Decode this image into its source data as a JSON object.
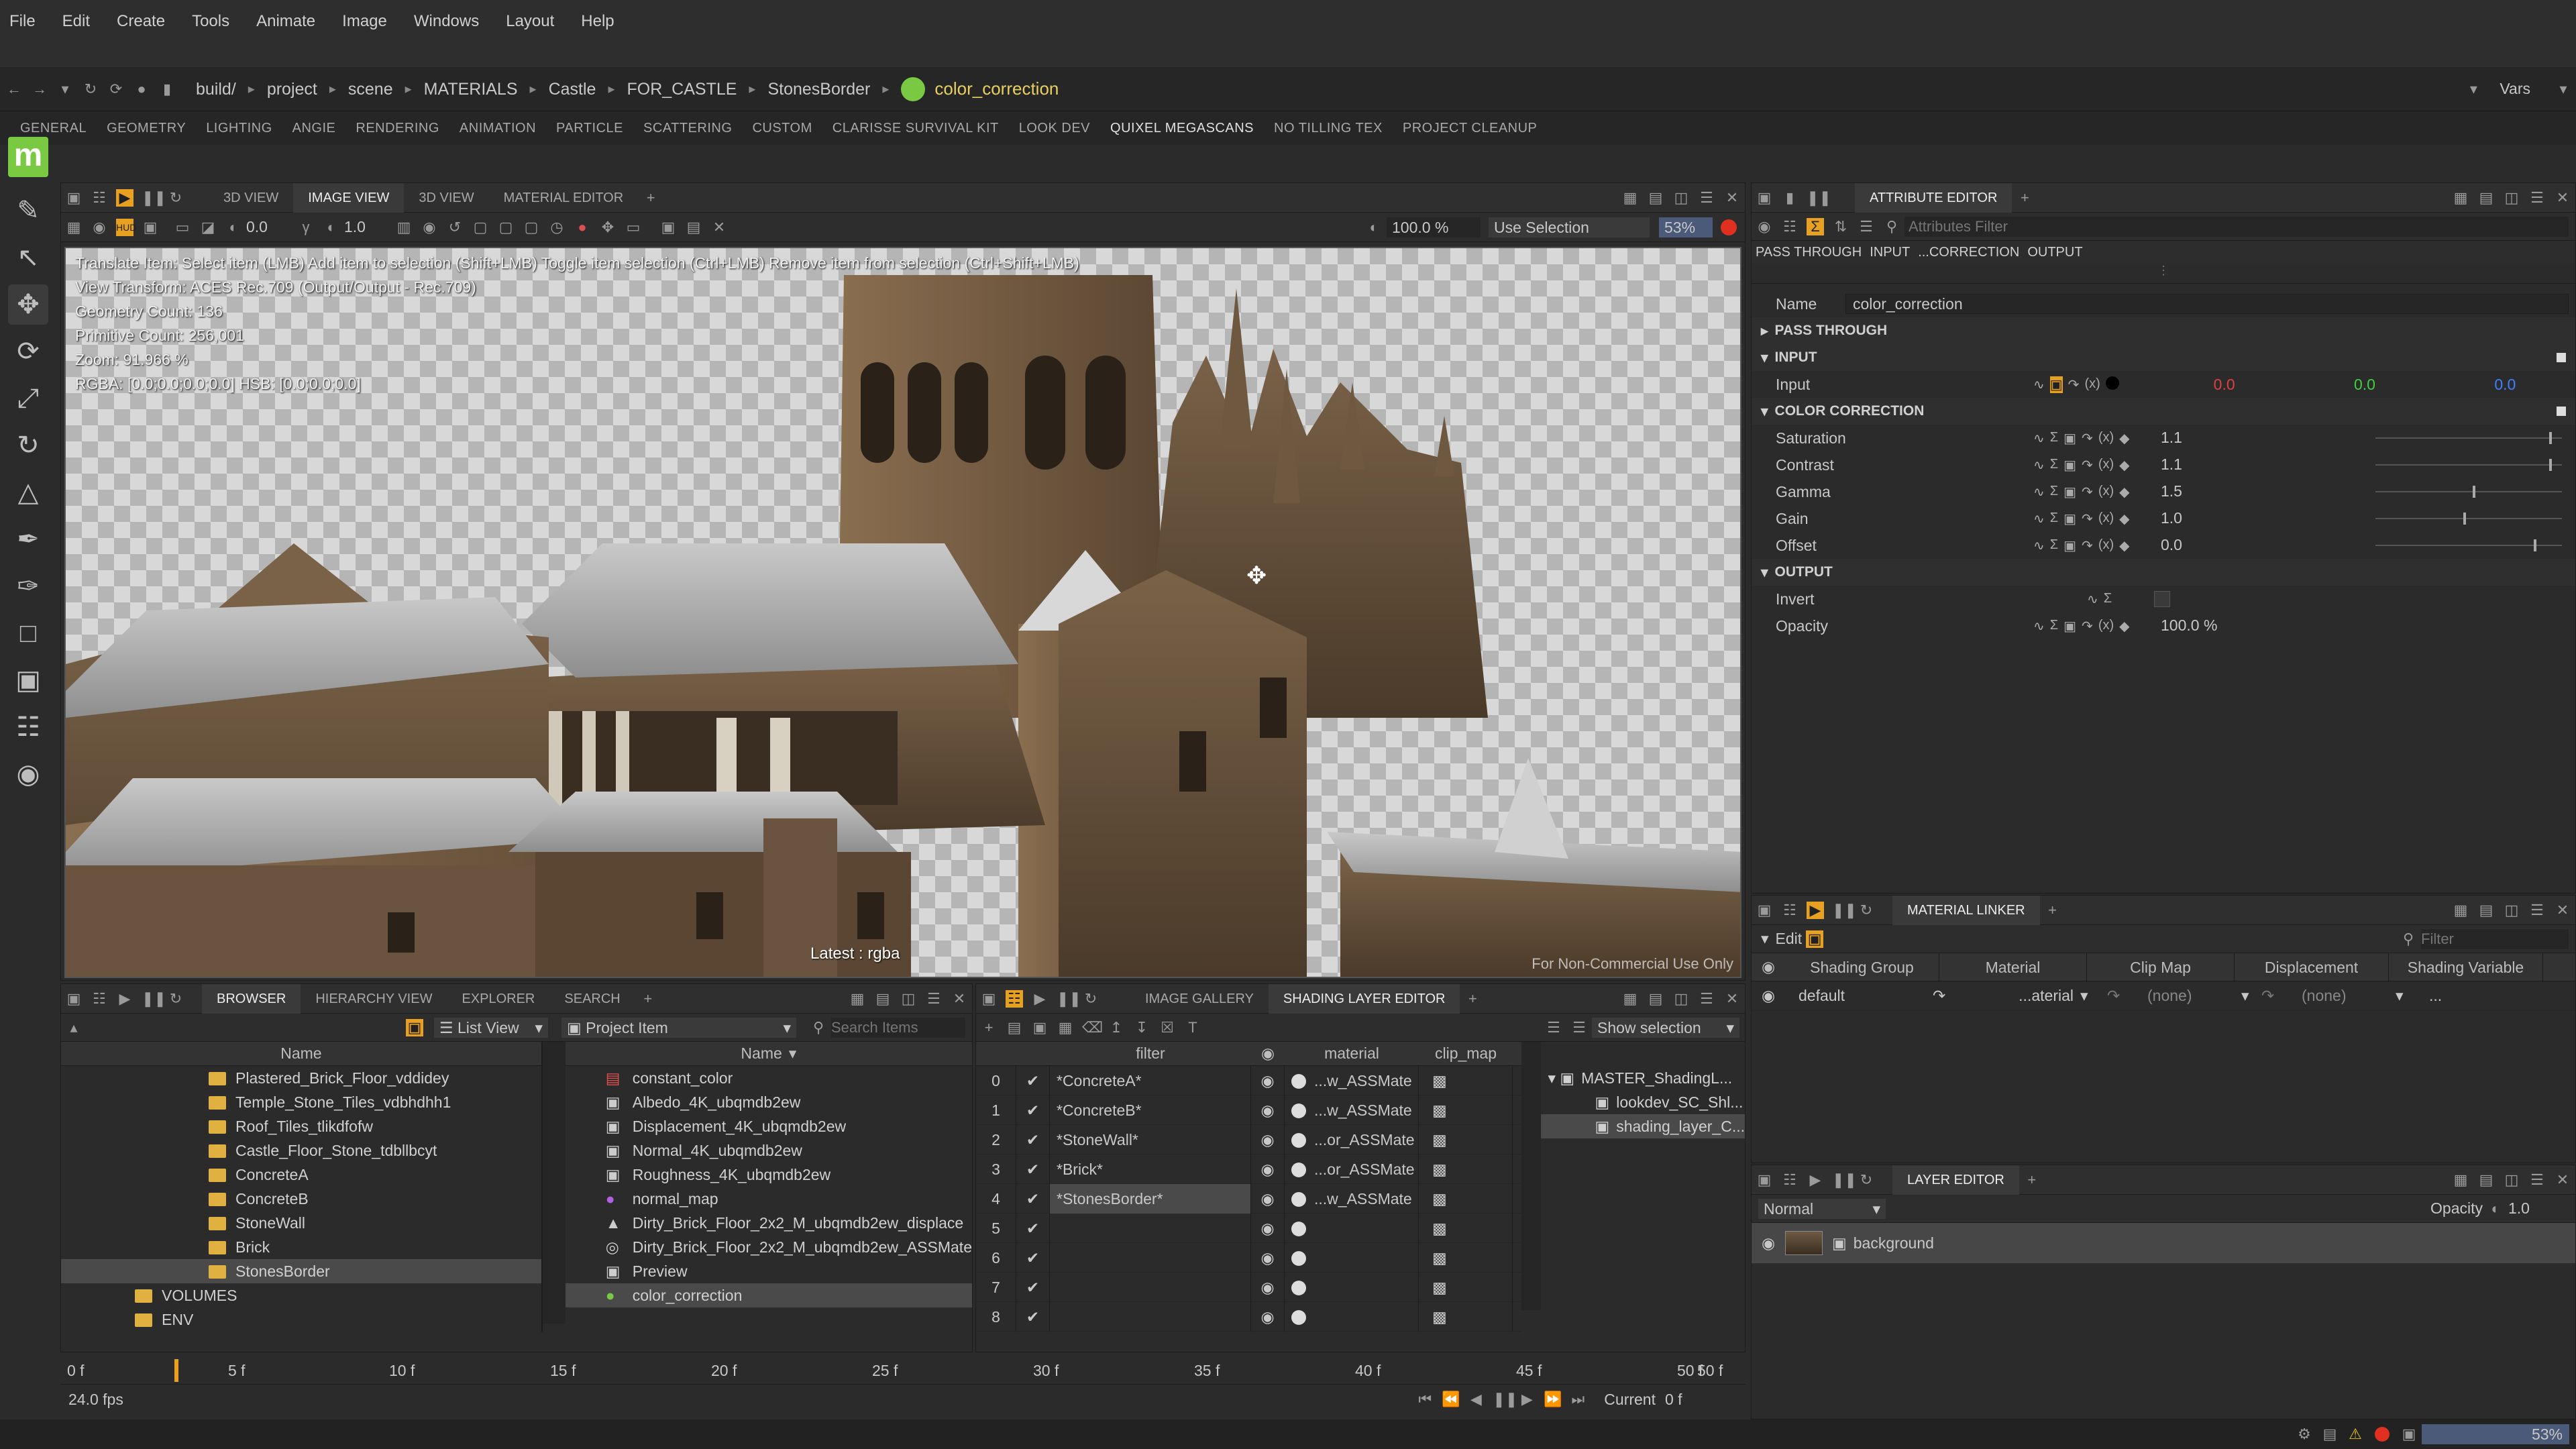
{
  "menubar": {
    "items": [
      "File",
      "Edit",
      "Create",
      "Tools",
      "Animate",
      "Image",
      "Windows",
      "Layout",
      "Help"
    ]
  },
  "path": {
    "crumbs": [
      "build/",
      "project",
      "scene",
      "MATERIALS",
      "Castle",
      "FOR_CASTLE",
      "StonesBorder"
    ],
    "current": "color_correction",
    "current_color": "#7ac943",
    "vars_label": "Vars"
  },
  "shelf_tabs": [
    "GENERAL",
    "GEOMETRY",
    "LIGHTING",
    "ANGIE",
    "RENDERING",
    "ANIMATION",
    "PARTICLE",
    "SCATTERING",
    "CUSTOM",
    "CLARISSE SURVIVAL KIT",
    "LOOK DEV",
    "QUIXEL MEGASCANS",
    "NO TILLING TEX",
    "PROJECT CLEANUP"
  ],
  "logo": {
    "letter": "m",
    "color": "#7ac943"
  },
  "viewer": {
    "tabs": [
      "3D VIEW",
      "IMAGE VIEW",
      "3D VIEW",
      "MATERIAL EDITOR"
    ],
    "active_tab": 1,
    "exposure": "0.0",
    "gamma": "1.0",
    "zoom_field": "100.0 %",
    "selection_mode": "Use Selection",
    "percent": "53",
    "percent_unit": "%",
    "info_lines": [
      "Translate Item: Select item (LMB) Add item to selection (Shift+LMB) Toggle item selection (Ctrl+LMB) Remove item from selection (Ctrl+Shift+LMB)",
      "View Transform: ACES Rec.709 (Output/Output - Rec.709)",
      "Geometry Count: 136",
      "Primitive Count: 256,001",
      "Zoom: 91.966 %",
      "RGBA: [0.0;0.0;0.0;0.0] HSB: [0.0;0.0;0.0]"
    ],
    "latest_label": "Latest : rgba",
    "watermark": "For Non-Commercial Use Only"
  },
  "attribute_editor": {
    "title": "ATTRIBUTE EDITOR",
    "filter_placeholder": "Attributes Filter",
    "subtabs": [
      "PASS THROUGH",
      "INPUT",
      "...CORRECTION",
      "OUTPUT"
    ],
    "name_label": "Name",
    "name_value": "color_correction",
    "sections": {
      "pass_through": "PASS THROUGH",
      "input": "INPUT",
      "color_correction": "COLOR CORRECTION",
      "output": "OUTPUT"
    },
    "input": {
      "label": "Input",
      "r": "0.0",
      "g": "0.0",
      "b": "0.0"
    },
    "cc_rows": [
      {
        "label": "Saturation",
        "value": "1.1",
        "slider": 0.93
      },
      {
        "label": "Contrast",
        "value": "1.1",
        "slider": 0.93
      },
      {
        "label": "Gamma",
        "value": "1.5",
        "slider": 0.52
      },
      {
        "label": "Gain",
        "value": "1.0",
        "slider": 0.47
      },
      {
        "label": "Offset",
        "value": "0.0",
        "slider": 0.85
      }
    ],
    "output": {
      "invert_label": "Invert",
      "opacity_label": "Opacity",
      "opacity_value": "100.0 %"
    }
  },
  "material_linker": {
    "title": "MATERIAL LINKER",
    "edit_label": "Edit",
    "filter_placeholder": "Filter",
    "columns": [
      "Shading Group",
      "Material",
      "Clip Map",
      "Displacement",
      "Shading Variable"
    ],
    "row": {
      "group": "default",
      "material": "...aterial",
      "clip": "(none)",
      "disp": "(none)",
      "var": "..."
    }
  },
  "layer_editor": {
    "title": "LAYER EDITOR",
    "blend": "Normal",
    "opacity_label": "Opacity",
    "opacity_value": "1.0",
    "layer": "background"
  },
  "browser": {
    "tabs": [
      "BROWSER",
      "HIERARCHY VIEW",
      "EXPLORER",
      "SEARCH"
    ],
    "view_mode": "List View",
    "item_mode": "Project Item",
    "search_placeholder": "Search Items",
    "tree_header": "Name",
    "list_header": "Name",
    "tree": [
      {
        "name": "Plastered_Brick_Floor_vddidey",
        "indent": 1
      },
      {
        "name": "Temple_Stone_Tiles_vdbhdhh1",
        "indent": 1
      },
      {
        "name": "Roof_Tiles_tlikdfofw",
        "indent": 1
      },
      {
        "name": "Castle_Floor_Stone_tdbllbcyt",
        "indent": 1
      },
      {
        "name": "ConcreteA",
        "indent": 1
      },
      {
        "name": "ConcreteB",
        "indent": 1
      },
      {
        "name": "StoneWall",
        "indent": 1
      },
      {
        "name": "Brick",
        "indent": 1
      },
      {
        "name": "StonesBorder",
        "indent": 1,
        "selected": true
      },
      {
        "name": "VOLUMES",
        "indent": 0
      },
      {
        "name": "ENV",
        "indent": 0
      }
    ],
    "items": [
      {
        "name": "constant_color",
        "icon": "color-icon"
      },
      {
        "name": "Albedo_4K_ubqmdb2ew",
        "icon": "texture-icon"
      },
      {
        "name": "Displacement_4K_ubqmdb2ew",
        "icon": "texture-icon"
      },
      {
        "name": "Normal_4K_ubqmdb2ew",
        "icon": "texture-icon"
      },
      {
        "name": "Roughness_4K_ubqmdb2ew",
        "icon": "texture-icon"
      },
      {
        "name": "normal_map",
        "icon": "normal-icon"
      },
      {
        "name": "Dirty_Brick_Floor_2x2_M_ubqmdb2ew_displace",
        "icon": "displace-icon"
      },
      {
        "name": "Dirty_Brick_Floor_2x2_M_ubqmdb2ew_ASSMate",
        "icon": "material-icon"
      },
      {
        "name": "Preview",
        "icon": "texture-icon"
      },
      {
        "name": "color_correction",
        "icon": "cc-icon",
        "selected": true
      }
    ]
  },
  "shading_layer": {
    "tabs": [
      "IMAGE GALLERY",
      "SHADING LAYER EDITOR"
    ],
    "show_selection": "Show selection",
    "columns": {
      "filter": "filter",
      "material": "material",
      "clip": "clip_map"
    },
    "rows": [
      {
        "idx": "0",
        "filter": "*ConcreteA*",
        "material": "...w_ASSMate"
      },
      {
        "idx": "1",
        "filter": "*ConcreteB*",
        "material": "...w_ASSMate"
      },
      {
        "idx": "2",
        "filter": "*StoneWall*",
        "material": "...or_ASSMate"
      },
      {
        "idx": "3",
        "filter": "*Brick*",
        "material": "...or_ASSMate"
      },
      {
        "idx": "4",
        "filter": "*StonesBorder*",
        "material": "...w_ASSMate",
        "selected": true
      },
      {
        "idx": "5",
        "filter": "",
        "material": ""
      },
      {
        "idx": "6",
        "filter": "",
        "material": ""
      },
      {
        "idx": "7",
        "filter": "",
        "material": ""
      },
      {
        "idx": "8",
        "filter": "",
        "material": ""
      }
    ],
    "tree": [
      "MASTER_ShadingL...",
      "lookdev_SC_Shl...",
      "shading_layer_C..."
    ]
  },
  "timeline": {
    "ticks": [
      "0 f",
      "5 f",
      "10 f",
      "15 f",
      "20 f",
      "25 f",
      "30 f",
      "35 f",
      "40 f",
      "45 f",
      "50 f"
    ],
    "start": "0 f",
    "end": "50 f",
    "fps": "24.0 fps",
    "current_label": "Current",
    "current_value": "0 f"
  },
  "status": {
    "percent": "53",
    "percent_unit": "%"
  }
}
